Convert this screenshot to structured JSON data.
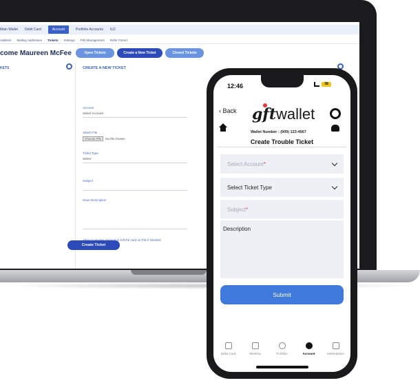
{
  "laptop": {
    "topnav": [
      {
        "label": "Main Wallet",
        "active": false
      },
      {
        "label": "Debit Card",
        "active": false
      },
      {
        "label": "Account",
        "active": true
      },
      {
        "label": "Portfolio Accounts",
        "active": false
      },
      {
        "label": "ILD",
        "active": false
      }
    ],
    "subnav": [
      {
        "label": "Address",
        "active": false
      },
      {
        "label": "Mailing Addresses",
        "active": false
      },
      {
        "label": "Tickets",
        "active": true
      },
      {
        "label": "Settings",
        "active": false
      },
      {
        "label": "PIN Management",
        "active": false
      },
      {
        "label": "Refer Friend",
        "active": false
      }
    ],
    "welcome": "come Maureen McFee",
    "buttons": {
      "open": "Open Tickets",
      "new": "Create a New Ticket",
      "closed": "Closed Tickets"
    },
    "left_header": "KETS",
    "form": {
      "header": "CREATE A NEW TICKET",
      "account_label": "Account",
      "account_value": "Select Account",
      "attach_label": "Attach File",
      "choose_file": "Choose File",
      "no_file": "No file chosen",
      "type_label": "Ticket Type",
      "type_value": "Select",
      "subject_label": "Subject",
      "issue_label": "Issue Description",
      "allow_label": "Allow Customer Support to Kill the card on File if Needed",
      "create_label": "Create Ticket"
    }
  },
  "phone": {
    "status": {
      "time": "12:46",
      "battery": "38"
    },
    "back_label": "Back",
    "logo_gft": "gft",
    "logo_wallet": "wallet",
    "wallet_number": "Wallet Number : (909) 123-4567",
    "title": "Create Trouble Ticket",
    "fields": {
      "account_placeholder": "Select Account",
      "ticket_type": "Select Ticket Type",
      "subject_placeholder": "Subject",
      "required_mark": "*",
      "description": "Description"
    },
    "submit_label": "Submit",
    "tabs": [
      {
        "label": "Debit Card",
        "icon": "card-icon",
        "active": false
      },
      {
        "label": "Wireless",
        "icon": "phone-icon",
        "active": false
      },
      {
        "label": "Portfolio",
        "icon": "clock-icon",
        "active": false
      },
      {
        "label": "Account",
        "icon": "gear-icon",
        "active": true
      },
      {
        "label": "Marketplace",
        "icon": "store-icon",
        "active": false
      }
    ]
  }
}
